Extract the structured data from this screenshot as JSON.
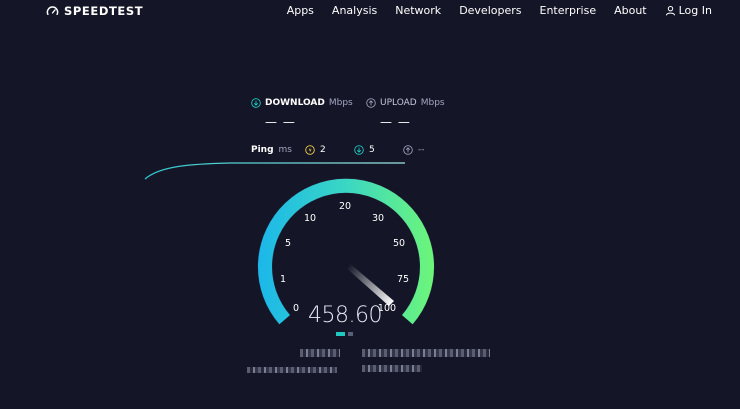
{
  "brand": {
    "name": "SPEEDTEST"
  },
  "nav": {
    "links": [
      "Apps",
      "Analysis",
      "Network",
      "Developers",
      "Enterprise",
      "About"
    ],
    "login": "Log In"
  },
  "download": {
    "label": "DOWNLOAD",
    "unit": "Mbps",
    "value": "— —"
  },
  "upload": {
    "label": "UPLOAD",
    "unit": "Mbps",
    "value": "— —"
  },
  "ping": {
    "label": "Ping",
    "unit": "ms",
    "idle": "2",
    "download": "5",
    "upload": "--"
  },
  "gauge": {
    "ticks": [
      "0",
      "1",
      "5",
      "10",
      "20",
      "30",
      "50",
      "75",
      "100"
    ],
    "reading": "458.60",
    "needle_value": 100
  },
  "colors": {
    "background": "#141526",
    "gauge_start": "#1cb8e9",
    "gauge_end": "#6cf57a",
    "accent": "#1fc9c0"
  }
}
